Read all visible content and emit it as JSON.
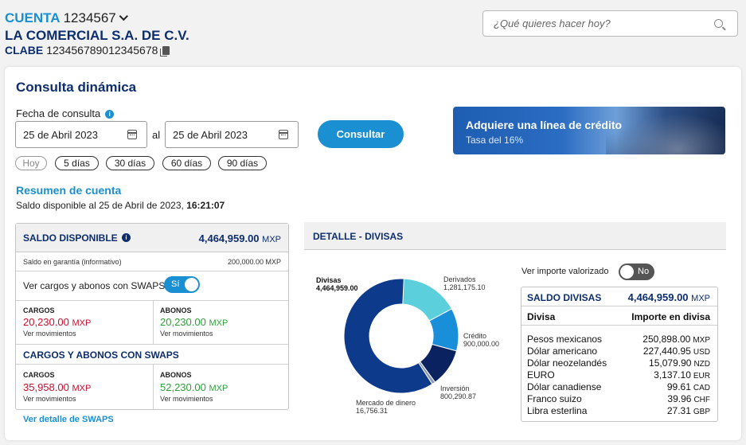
{
  "header": {
    "account_label": "CUENTA",
    "account_number": "1234567",
    "company": "LA COMERCIAL S.A. DE C.V.",
    "clabe_label": "CLABE",
    "clabe_value": "123456789012345678",
    "search_placeholder": "¿Qué quieres hacer hoy?"
  },
  "consulta": {
    "title": "Consulta dinámica",
    "fecha_label": "Fecha de consulta",
    "date_from": "25 de Abril 2023",
    "al": "al",
    "date_to": "25 de Abril 2023",
    "consultar_label": "Consultar",
    "ranges": [
      "Hoy",
      "5 días",
      "30 días",
      "60 días",
      "90 días"
    ]
  },
  "banner": {
    "title": "Adquiere una línea de crédito",
    "subtitle": "Tasa del 16%"
  },
  "resumen": {
    "title": "Resumen de cuenta",
    "saldo_text": "Saldo disponible al 25 de Abril de 2023, ",
    "saldo_time": "16:21:07"
  },
  "saldo_panel": {
    "title": "SALDO DISPONIBLE",
    "amount": "4,464,959.00",
    "currency": "MXP",
    "garantia_label": "Saldo en garantía (informativo)",
    "garantia_value": "200,000.00 MXP",
    "swaps_toggle_label": "Ver cargos y abonos con SWAPS",
    "swaps_toggle_state": "Sí",
    "cargos_label": "CARGOS",
    "cargos_amount": "20,230.00",
    "abonos_label": "ABONOS",
    "abonos_amount": "20,230.00",
    "ver_movimientos": "Ver movimientos",
    "swaps_title": "CARGOS Y ABONOS CON SWAPS",
    "swaps_cargos_amount": "35,958.00",
    "swaps_abonos_amount": "52,230.00",
    "ver_detalle_swaps": "Ver detalle de SWAPS"
  },
  "detalle": {
    "title": "DETALLE - DIVISAS",
    "ver_importe_label": "Ver importe valorizado",
    "ver_importe_state": "No",
    "saldo_title": "SALDO DIVISAS",
    "saldo_amount": "4,464,959.00",
    "saldo_currency": "MXP",
    "col_divisa": "Divisa",
    "col_importe": "Importe en divisa",
    "rows": [
      {
        "name": "Pesos mexicanos",
        "value": "250,898.00",
        "code": "MXP"
      },
      {
        "name": "Dólar americano",
        "value": "227,440.95",
        "code": "USD"
      },
      {
        "name": "Dólar neozelandés",
        "value": "15,079.90",
        "code": "NZD"
      },
      {
        "name": "EURO",
        "value": "3,137.10",
        "code": "EUR"
      },
      {
        "name": "Dólar canadiense",
        "value": "99.61",
        "code": "CAD"
      },
      {
        "name": "Franco suizo",
        "value": "39.96",
        "code": "CHF"
      },
      {
        "name": "Libra esterlina",
        "value": "27.31",
        "code": "GBP"
      }
    ]
  },
  "chart_data": {
    "type": "pie",
    "title": "",
    "segments": [
      {
        "label": "Divisas",
        "value": 4464959.0,
        "value_text": "4,464,959.00",
        "color": "#0e3a8c"
      },
      {
        "label": "Derivados",
        "value": 1281175.1,
        "value_text": "1,281,175.10",
        "color": "#5bd0dc"
      },
      {
        "label": "Crédito",
        "value": 900000.0,
        "value_text": "900,000.00",
        "color": "#1a8fd9"
      },
      {
        "label": "Inversión",
        "value": 800290.87,
        "value_text": "800,290.87",
        "color": "#0b2260"
      },
      {
        "label": "Mercado de dinero",
        "value": 16756.31,
        "value_text": "16,756.31",
        "color": "#8a9ab5"
      }
    ]
  }
}
